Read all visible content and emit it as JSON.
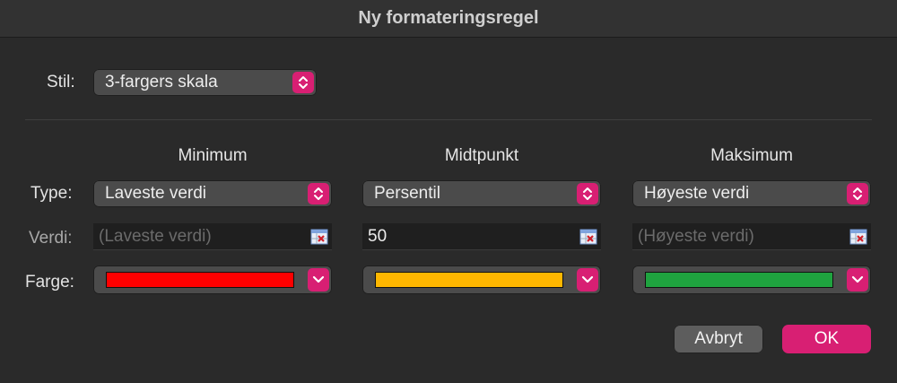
{
  "window": {
    "title": "Ny formateringsregel"
  },
  "style": {
    "label": "Stil:",
    "value": "3-fargers skala"
  },
  "row_labels": {
    "type": "Type:",
    "value": "Verdi:",
    "color": "Farge:"
  },
  "columns": [
    {
      "heading": "Minimum",
      "type": "Laveste verdi",
      "value": "",
      "placeholder": "(Laveste verdi)",
      "color": "#ff0000"
    },
    {
      "heading": "Midtpunkt",
      "type": "Persentil",
      "value": "50",
      "placeholder": "",
      "color": "#ffb700"
    },
    {
      "heading": "Maksimum",
      "type": "Høyeste verdi",
      "value": "",
      "placeholder": "(Høyeste verdi)",
      "color": "#1fa33f"
    }
  ],
  "buttons": {
    "cancel": "Avbryt",
    "ok": "OK"
  },
  "colors": {
    "accent": "#d81f73",
    "background": "#2a2a2a"
  },
  "icons": {
    "stepper": "up-down-chevron-icon",
    "dropdown": "chevron-down-icon",
    "cell_picker": "cell-reference-picker-icon"
  }
}
